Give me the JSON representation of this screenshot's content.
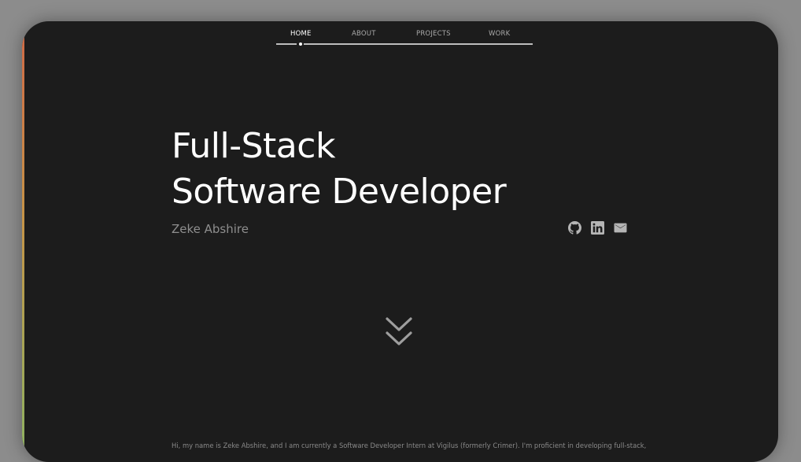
{
  "nav": {
    "items": [
      {
        "label": "HOME",
        "active": true
      },
      {
        "label": "ABOUT",
        "active": false
      },
      {
        "label": "PROJECTS",
        "active": false
      },
      {
        "label": "WORK",
        "active": false
      }
    ]
  },
  "hero": {
    "title_line1": "Full-Stack",
    "title_line2": "Software Developer",
    "name": "Zeke Abshire"
  },
  "socials": [
    {
      "icon": "github-icon"
    },
    {
      "icon": "linkedin-icon"
    },
    {
      "icon": "email-icon"
    }
  ],
  "scroll_indicator": {
    "icon": "double-chevron-down-icon"
  },
  "intro": {
    "text": "Hi, my name is Zeke Abshire, and I am currently a Software Developer Intern at Vigilus (formerly Crimer). I'm proficient in developing full-stack,"
  },
  "colors": {
    "background": "#1c1c1c",
    "outer": "#8c8c8c",
    "text_primary": "#ffffff",
    "text_muted": "#8e8e8e",
    "accent_top": "#e5704b",
    "accent_bottom": "#99c46a"
  }
}
